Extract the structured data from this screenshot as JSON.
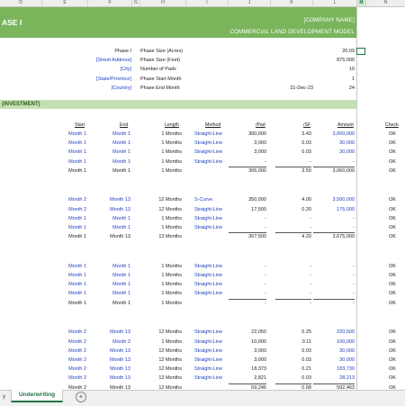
{
  "columns": [
    "D",
    "E",
    "F",
    "G",
    "H",
    "I",
    "J",
    "K",
    "L",
    "M",
    "N"
  ],
  "banner": {
    "title": "ASE I",
    "company": "[COMPANY NAME]",
    "model": "COMMERCIAL LAND DEVELOPMENT MODEL"
  },
  "info": [
    {
      "label": "Phase I",
      "key": "Phase Size (Acres)",
      "value": "20.09"
    },
    {
      "label": "[Street Address]",
      "key": "Phase Size (Feet)",
      "value": "875,000"
    },
    {
      "label": "[City]",
      "key": "Number of Pads",
      "value": "10"
    },
    {
      "label": "[State/Province]",
      "key": "Phase Start Month",
      "value": "1"
    },
    {
      "label": "[Country]",
      "key": "Phase End Month",
      "value": "24",
      "date": "31-Dec-23"
    }
  ],
  "section_label": "(INVESTMENT)",
  "headers": {
    "start": "Start",
    "end": "End",
    "length": "Length",
    "method": "Method",
    "pad": "/Pad",
    "sf": "/SF",
    "amount": "Amount",
    "check": "Check"
  },
  "rows": [
    {
      "s": "Month 1",
      "e": "Month 1",
      "l": "1 Months",
      "m": "Straight-Line",
      "p": "300,000",
      "f": "3.43",
      "a": "3,000,000",
      "c": "OK",
      "blue": true
    },
    {
      "s": "Month 1",
      "e": "Month 1",
      "l": "1 Months",
      "m": "Straight-Line",
      "p": "3,000",
      "f": "0.03",
      "a": "30,000",
      "c": "OK",
      "blue": true
    },
    {
      "s": "Month 1",
      "e": "Month 1",
      "l": "1 Months",
      "m": "Straight-Line",
      "p": "3,000",
      "f": "0.03",
      "a": "30,000",
      "c": "OK",
      "blue": true
    },
    {
      "s": "Month 1",
      "e": "Month 1",
      "l": "1 Months",
      "m": "Straight-Line",
      "p": "-",
      "f": "-",
      "a": "-",
      "c": "OK",
      "blue": true
    },
    {
      "s": "Month 1",
      "e": "Month 1",
      "l": "1 Months",
      "m": "",
      "p": "306,000",
      "f": "3.50",
      "a": "3,060,000",
      "c": "OK",
      "blue": false,
      "total": true
    },
    {
      "gap": true
    },
    {
      "s": "Month 2",
      "e": "Month 13",
      "l": "12 Months",
      "m": "S-Curve",
      "p": "350,000",
      "f": "4.00",
      "a": "3,500,000",
      "c": "OK",
      "blue": true
    },
    {
      "s": "Month 2",
      "e": "Month 13",
      "l": "12 Months",
      "m": "Straight-Line",
      "p": "17,500",
      "f": "0.20",
      "a": "175,000",
      "c": "OK",
      "blue": true
    },
    {
      "s": "Month 1",
      "e": "Month 1",
      "l": "1 Months",
      "m": "Straight-Line",
      "p": "-",
      "f": "-",
      "a": "-",
      "c": "OK",
      "blue": true
    },
    {
      "s": "Month 1",
      "e": "Month 1",
      "l": "1 Months",
      "m": "Straight-Line",
      "p": "-",
      "f": "-",
      "a": "-",
      "c": "OK",
      "blue": true
    },
    {
      "s": "Month 1",
      "e": "Month 13",
      "l": "13 Months",
      "m": "",
      "p": "367,500",
      "f": "4.20",
      "a": "3,675,000",
      "c": "OK",
      "blue": false,
      "total": true
    },
    {
      "gap": true
    },
    {
      "s": "Month 1",
      "e": "Month 1",
      "l": "1 Months",
      "m": "Straight-Line",
      "p": "-",
      "f": "-",
      "a": "-",
      "c": "OK",
      "blue": true
    },
    {
      "s": "Month 1",
      "e": "Month 1",
      "l": "1 Months",
      "m": "Straight-Line",
      "p": "-",
      "f": "-",
      "a": "-",
      "c": "OK",
      "blue": true
    },
    {
      "s": "Month 1",
      "e": "Month 1",
      "l": "1 Months",
      "m": "Straight-Line",
      "p": "-",
      "f": "-",
      "a": "-",
      "c": "OK",
      "blue": true
    },
    {
      "s": "Month 1",
      "e": "Month 1",
      "l": "1 Months",
      "m": "Straight-Line",
      "p": "-",
      "f": "-",
      "a": "-",
      "c": "OK",
      "blue": true
    },
    {
      "s": "Month 1",
      "e": "Month 1",
      "l": "1 Months",
      "m": "",
      "p": "-",
      "f": "-",
      "a": "-",
      "c": "OK",
      "blue": false,
      "total": true
    },
    {
      "gap": true
    },
    {
      "s": "Month 2",
      "e": "Month 13",
      "l": "12 Months",
      "m": "Straight-Line",
      "p": "22,050",
      "f": "0.25",
      "a": "220,500",
      "c": "OK",
      "blue": true
    },
    {
      "s": "Month 2",
      "e": "Month 2",
      "l": "1 Months",
      "m": "Straight-Line",
      "p": "10,000",
      "f": "0.11",
      "a": "100,000",
      "c": "OK",
      "blue": true
    },
    {
      "s": "Month 2",
      "e": "Month 13",
      "l": "12 Months",
      "m": "Straight-Line",
      "p": "3,000",
      "f": "0.03",
      "a": "30,000",
      "c": "OK",
      "blue": true
    },
    {
      "s": "Month 2",
      "e": "Month 13",
      "l": "12 Months",
      "m": "Straight-Line",
      "p": "3,000",
      "f": "0.03",
      "a": "30,000",
      "c": "OK",
      "blue": true
    },
    {
      "s": "Month 2",
      "e": "Month 13",
      "l": "12 Months",
      "m": "Straight-Line",
      "p": "18,373",
      "f": "0.21",
      "a": "183,730",
      "c": "OK",
      "blue": true
    },
    {
      "s": "Month 2",
      "e": "Month 13",
      "l": "12 Months",
      "m": "Straight-Line",
      "p": "2,821",
      "f": "0.03",
      "a": "28,213",
      "c": "OK",
      "blue": true
    },
    {
      "s": "Month 2",
      "e": "Month 13",
      "l": "12 Months",
      "m": "",
      "p": "59,246",
      "f": "0.68",
      "a": "592,463",
      "c": "OK",
      "blue": false,
      "total": true
    }
  ],
  "tabs": {
    "prev": "y",
    "active": "Underwriting",
    "add": "+"
  }
}
